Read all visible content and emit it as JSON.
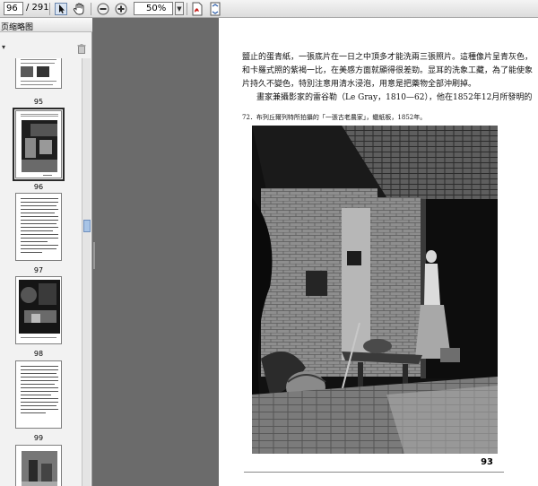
{
  "toolbar": {
    "page_current": "96",
    "page_total": "/ 291",
    "zoom": "50%",
    "icons": [
      "select-text-icon",
      "hand-tool-icon",
      "zoom-out-icon",
      "zoom-in-icon",
      "pdf-export-icon",
      "fit-page-icon"
    ]
  },
  "sidebar": {
    "title": "页缩略图",
    "menu": "▾",
    "thumbnails": [
      {
        "label": "95"
      },
      {
        "label": "96"
      },
      {
        "label": "97"
      },
      {
        "label": "98"
      },
      {
        "label": "99"
      }
    ]
  },
  "page": {
    "lines": [
      "鹽止的蛋青紙，一張底片在一日之中頂多才能洗兩三張照片。這種像片呈青灰色，",
      "和卡羅式照的紫褐一比，在美感方面就顯得很差勁。显耳的洗象工藏，為了能使象",
      "片持久不變色，特別注意用清水浸泡，用意是把藥物全部沖刷掉。",
      "畫家兼攝影家的雷谷勒（Le Gray，1810—62），他在1852年12月所發明的"
    ],
    "caption": "72．布列丘爾列特所拍攝的「一張古老農家」，蠟紙板，1852年。",
    "page_number": "93"
  },
  "colors": {
    "app_bg": "#6b6b6b",
    "accent": "#2a2a2a"
  }
}
